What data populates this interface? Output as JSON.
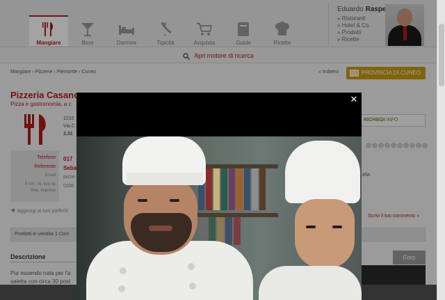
{
  "nav": {
    "items": [
      {
        "label": "Mangiare",
        "icon": "cutlery-icon",
        "active": true
      },
      {
        "label": "Bere",
        "icon": "cocktail-icon",
        "active": false
      },
      {
        "label": "Dormire",
        "icon": "bed-icon",
        "active": false
      },
      {
        "label": "Tipicità",
        "icon": "italy-map-icon",
        "active": false
      },
      {
        "label": "Acquista",
        "icon": "cart-icon",
        "active": false
      },
      {
        "label": "Guide",
        "icon": "guide-book-icon",
        "active": false
      },
      {
        "label": "Ricette",
        "icon": "chef-hat-icon",
        "active": false
      }
    ]
  },
  "user": {
    "first_name": "Eduardo",
    "last_name": "Raspelli",
    "links": [
      "» Ristoranti",
      "» Hotel & Co.",
      "» Prodotti",
      "» Ricette"
    ]
  },
  "search": {
    "label": "Apri motore di ricerca"
  },
  "breadcrumb": {
    "root": "Mangiare",
    "items": [
      "Pizzerie",
      "Piemonte",
      "Cuneo"
    ],
    "sep": "›"
  },
  "back": {
    "label": "« Indietro"
  },
  "province_button": {
    "label": "PROVINCIA DI CUNEO"
  },
  "restaurant": {
    "type": "Pizzeria",
    "name": "Casanova",
    "subtitle": "Pizza e gastronomia, a c",
    "address_lines": [
      "1210",
      "Via C",
      "2,31"
    ]
  },
  "richiedi": {
    "strong": "RICHIEDI",
    "text": "INFO"
  },
  "contact": {
    "phone_label": "Telefono",
    "ref_label": "Referente",
    "email_label": "Email",
    "piva_label": "P.IVA - N. Iscr.ne",
    "reg_label": "Reg. Imprese",
    "phone_value": "017",
    "ref_value": "Seba",
    "email_value": "pizze",
    "piva_value": "0330"
  },
  "extra": {
    "text": "ella."
  },
  "favorites": {
    "label": "Aggiungi ai tuoi preferiti"
  },
  "comment": {
    "label": "Scrivi il tuo commento »"
  },
  "products": {
    "label": "Prodotti in vendita 1 Com"
  },
  "description": {
    "title": "Descrizione",
    "line1": "Pur essendo nata per l'a",
    "line2": "saletta con circa 30 post"
  },
  "photo_tab": {
    "label": "Foto"
  },
  "modal": {
    "close": "✕"
  }
}
